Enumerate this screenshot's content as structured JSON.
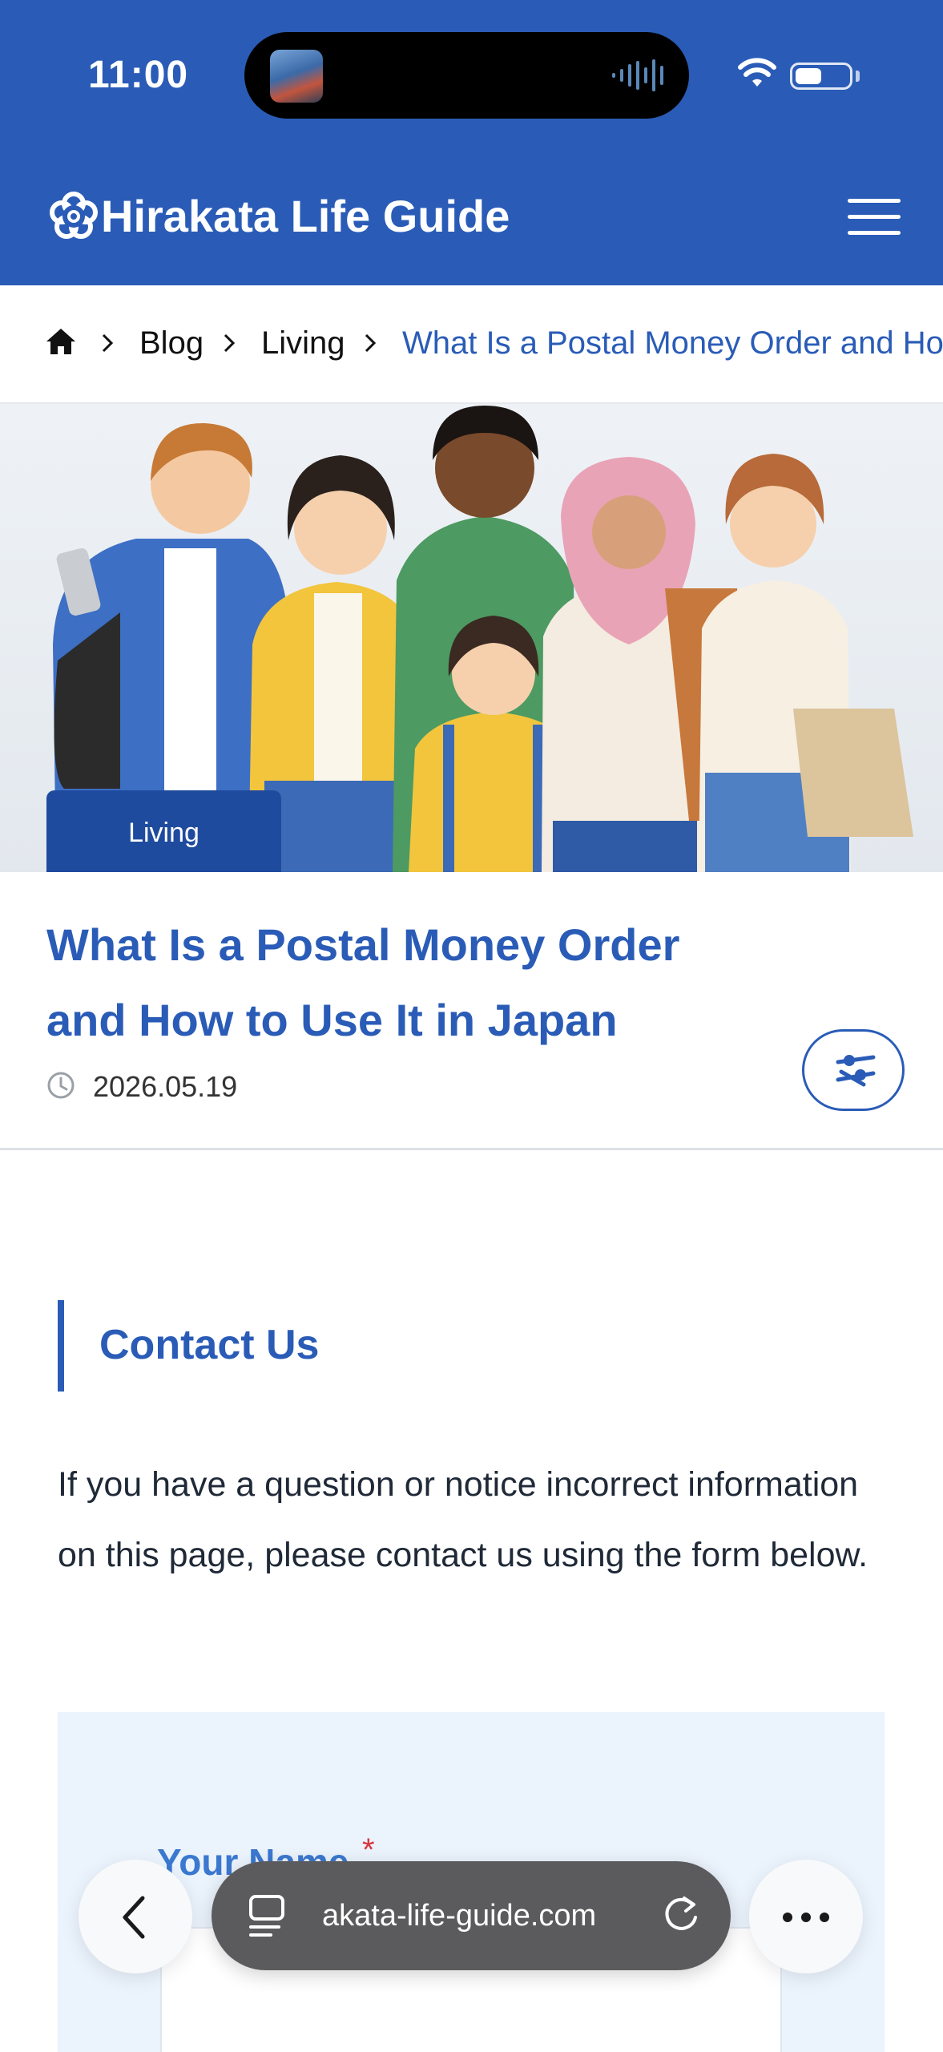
{
  "status_bar": {
    "time": "11:00"
  },
  "header": {
    "site_title": "Hirakata Life Guide",
    "icons": [
      "flower-logo-icon",
      "hamburger-menu-icon"
    ],
    "background_color": "#2a5cb7"
  },
  "breadcrumb": {
    "items": [
      "Blog",
      "Living",
      "What Is a Postal Money Order and How to Use It in Japan"
    ],
    "home_icon": "home-icon"
  },
  "hero": {
    "category_tag": "Living"
  },
  "article": {
    "title": "What Is a Postal Money Order and How to Use It in Japan",
    "date": "2026.05.19"
  },
  "contact": {
    "heading": "Contact Us",
    "body": "If you have a question or notice incorrect information on this page, please contact us using the form below.",
    "form": {
      "name_label": "Your Name",
      "required_mark": "*"
    }
  },
  "browser": {
    "url": "akata-life-guide.com"
  },
  "colors": {
    "accent": "#2a5cb7",
    "tag": "#1e4b9e",
    "form_bg": "#ebf3fd"
  }
}
